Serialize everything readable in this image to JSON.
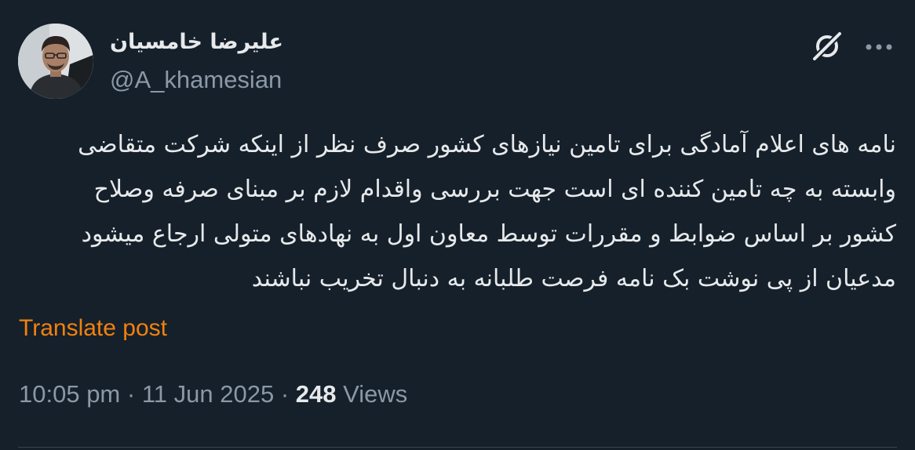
{
  "author": {
    "display_name": "علیرضا خامسیان",
    "handle": "@A_khamesian"
  },
  "icons": {
    "grok": "grok-icon",
    "more": "more-icon"
  },
  "tweet": {
    "lines": [
      "نامه های اعلام آمادگی برای تامین نیازهای کشور صرف نظر از اینکه شرکت متقاضی",
      "وابسته به چه تامین کننده ای است جهت بررسی واقدام لازم بر مبنای صرفه وصلاح",
      "کشور بر اساس ضوابط و مقررات توسط معاون اول به نهادهای متولی ارجاع میشود",
      "مدعیان از پی نوشت بک نامه فرصت طلبانه به دنبال تخریب نباشند"
    ],
    "translate_label": "Translate post"
  },
  "meta": {
    "time": "10:05 pm",
    "separator": "·",
    "date": "11 Jun 2025",
    "views_count": "248",
    "views_label": "Views"
  },
  "colors": {
    "background": "#15202b",
    "text": "#e7e9ea",
    "secondary": "#8b98a5",
    "translate_accent": "#f2810e"
  }
}
